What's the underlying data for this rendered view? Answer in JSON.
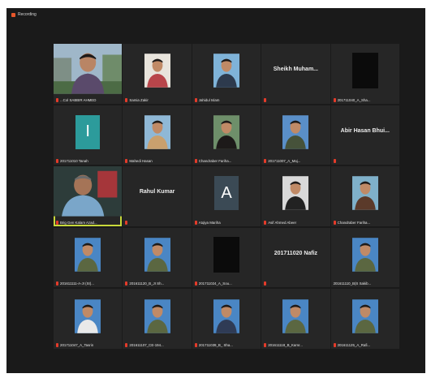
{
  "recording": {
    "label": "Recording"
  },
  "tiles": [
    {
      "kind": "video-outdoor",
      "label": "...Col SABBIR AHMED",
      "muted": true
    },
    {
      "kind": "photo",
      "label": "Samia Zakir",
      "muted": true,
      "bg": "#e8e4dc",
      "fg": "#b8454a"
    },
    {
      "kind": "photo",
      "label": "Jahidul Islam",
      "muted": true,
      "bg": "#7fb3d8",
      "fg": "#2d3a4d"
    },
    {
      "kind": "name",
      "label": "",
      "name": "Sheikh  Muham...",
      "muted": true
    },
    {
      "kind": "dark",
      "label": "201711040_A_Sha...",
      "muted": true
    },
    {
      "kind": "initial",
      "label": "201711010 Tanah",
      "muted": true,
      "letter": "I",
      "teal": true
    },
    {
      "kind": "photo",
      "label": "Mahedi Hasan",
      "muted": true,
      "bg": "#8fb8d6",
      "fg": "#c9a06e"
    },
    {
      "kind": "photo",
      "label": "Chandraber Fariha...",
      "muted": true,
      "bg": "#6e8f6a",
      "fg": "#1d1a19"
    },
    {
      "kind": "photo",
      "label": "201711007_A_Maj...",
      "muted": true,
      "bg": "#5a8fc8",
      "fg": "#46523a"
    },
    {
      "kind": "name",
      "label": "",
      "name": "Abir Hasan Bhui...",
      "muted": true
    },
    {
      "kind": "video-person",
      "label": "Brig Gen Kalam Azad...",
      "muted": true,
      "active": true
    },
    {
      "kind": "name",
      "label": "",
      "name": "Rahul Kumar",
      "muted": true
    },
    {
      "kind": "initial",
      "label": "Atqiya Mariha",
      "muted": true,
      "letter": "A",
      "teal": false
    },
    {
      "kind": "photo",
      "label": "Asif Ahmed Abeer",
      "muted": true,
      "bg": "#d9d9d9",
      "fg": "#222222"
    },
    {
      "kind": "photo",
      "label": "Chandraber Fariha...",
      "muted": true,
      "bg": "#7fb0c9",
      "fg": "#5b3a2a"
    },
    {
      "kind": "photo",
      "label": "201611111-A-JI (SI)...",
      "muted": true,
      "bg": "#4a86c4",
      "fg": "#5b6741"
    },
    {
      "kind": "photo",
      "label": "201611120_B_JI Sh...",
      "muted": true,
      "bg": "#4a86c4",
      "fg": "#5b6741"
    },
    {
      "kind": "dark",
      "label": "201711024_A_Sou...",
      "muted": true
    },
    {
      "kind": "name",
      "label": "",
      "name": "201711020 Nafiz",
      "muted": true
    },
    {
      "kind": "photo",
      "label": "201611110_B(S Sakib...",
      "muted": false,
      "bg": "#4a86c4",
      "fg": "#5b6741"
    },
    {
      "kind": "photo",
      "label": "201711047_A_Tasrin",
      "muted": true,
      "bg": "#4a86c4",
      "fg": "#e9e9e9"
    },
    {
      "kind": "photo",
      "label": "201611107_CE-194...",
      "muted": true,
      "bg": "#4a86c4",
      "fg": "#5b6741"
    },
    {
      "kind": "photo",
      "label": "201711039_B_ Sha...",
      "muted": true,
      "bg": "#4a86c4",
      "fg": "#2f3b55"
    },
    {
      "kind": "photo",
      "label": "201611118_B_Kamr...",
      "muted": true,
      "bg": "#4a86c4",
      "fg": "#5b6741"
    },
    {
      "kind": "photo",
      "label": "201611125_A_Rafi...",
      "muted": true,
      "bg": "#4a86c4",
      "fg": "#5b6741"
    }
  ]
}
